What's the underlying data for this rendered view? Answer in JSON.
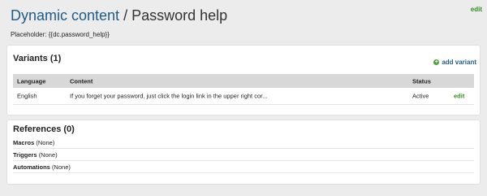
{
  "header": {
    "breadcrumb": "Dynamic content",
    "separator": "/",
    "page_title": "Password help",
    "edit_label": "edit",
    "placeholder_label": "Placeholder:",
    "placeholder_value": "{{dc.password_help}}"
  },
  "variants": {
    "title": "Variants (1)",
    "add_label": "add variant",
    "add_icon": "plus-circle-icon",
    "columns": [
      "Language",
      "Content",
      "Status"
    ],
    "rows": [
      {
        "language": "English",
        "content": "If you forget your password, just click the login link in the upper right cor...",
        "status": "Active",
        "edit": "edit"
      }
    ]
  },
  "references": {
    "title": "References (0)",
    "items": [
      {
        "name": "Macros",
        "value": "(None)"
      },
      {
        "name": "Triggers",
        "value": "(None)"
      },
      {
        "name": "Automations",
        "value": "(None)"
      }
    ]
  },
  "colors": {
    "link_blue": "#1d5d86",
    "edit_green": "#2f8f1f",
    "add_icon_green": "#49a33b"
  }
}
